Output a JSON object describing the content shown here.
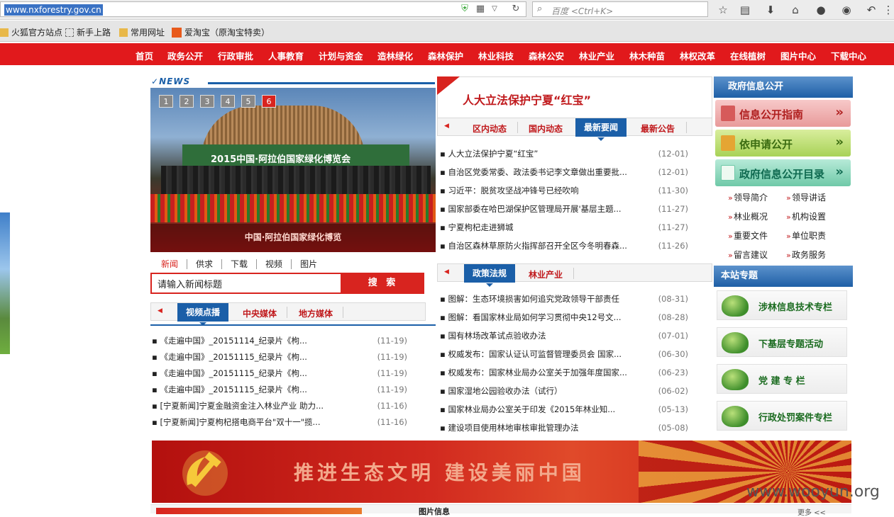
{
  "browser": {
    "url": "www.nxforestry.gov.cn",
    "search_placeholder": "百度 <Ctrl+K>",
    "bookmarks": [
      "火狐官方站点",
      "新手上路",
      "常用网址",
      "爱淘宝（原淘宝特卖）"
    ]
  },
  "nav": {
    "items": [
      "首页",
      "政务公开",
      "行政审批",
      "人事教育",
      "计划与资金",
      "造林绿化",
      "森林保护",
      "林业科技",
      "森林公安",
      "林业产业",
      "林木种苗",
      "林权改革",
      "在线植树",
      "图片中心",
      "下载中心"
    ]
  },
  "slider": {
    "numbers": [
      "1",
      "2",
      "3",
      "4",
      "5",
      "6"
    ],
    "active": "6",
    "board_text": "2015中国·阿拉伯国家绿化博览会",
    "caption": "中国·阿拉伯国家绿化博览"
  },
  "news_logo": "NEWS",
  "search": {
    "categories": [
      "新闻",
      "供求",
      "下载",
      "视频",
      "图片"
    ],
    "value": "请输入新闻标题",
    "button": "搜 索"
  },
  "video_tabs": [
    "视频点播",
    "中央媒体",
    "地方媒体"
  ],
  "video_list": [
    {
      "title": "《走遍中国》_20151114_纪录片《枸...",
      "date": "(11-19)"
    },
    {
      "title": "《走遍中国》_20151115_纪录片《枸...",
      "date": "(11-19)"
    },
    {
      "title": "《走遍中国》_20151115_纪录片《枸...",
      "date": "(11-19)"
    },
    {
      "title": "《走遍中国》_20151115_纪录片《枸...",
      "date": "(11-19)"
    },
    {
      "title": "[宁夏新闻]宁夏金融资金注入林业产业 助力...",
      "date": "(11-16)"
    },
    {
      "title": "[宁夏新闻]宁夏枸杞搭电商平台\"双十一\"揽...",
      "date": "(11-16)"
    }
  ],
  "headline": "人大立法保护宁夏“红宝”",
  "news_tabs": [
    "区内动态",
    "国内动态",
    "最新要闻",
    "最新公告"
  ],
  "news_list": [
    {
      "title": "人大立法保护宁夏“红宝”",
      "date": "(12-01)"
    },
    {
      "title": "自治区党委常委、政法委书记李文章做出重要批...",
      "date": "(12-01)"
    },
    {
      "title": "习近平：脱贫攻坚战冲锋号已经吹响",
      "date": "(11-30)"
    },
    {
      "title": "国家部委在哈巴湖保护区管理局开展'基层主题...",
      "date": "(11-27)"
    },
    {
      "title": "宁夏枸杞走进狮城",
      "date": "(11-27)"
    },
    {
      "title": "自治区森林草原防火指挥部召开全区今冬明春森...",
      "date": "(11-26)"
    }
  ],
  "policy_tabs": [
    "政策法规",
    "林业产业"
  ],
  "policy_list": [
    {
      "title": "图解：生态环境损害如何追究党政领导干部责任",
      "date": "(08-31)"
    },
    {
      "title": "图解：看国家林业局如何学习贯彻中央12号文...",
      "date": "(08-28)"
    },
    {
      "title": "国有林场改革试点验收办法",
      "date": "(07-01)"
    },
    {
      "title": "权威发布：国家认证认可监督管理委员会 国家...",
      "date": "(06-30)"
    },
    {
      "title": "权威发布：国家林业局办公室关于加强年度国家...",
      "date": "(06-23)"
    },
    {
      "title": "国家湿地公园验收办法（试行）",
      "date": "(06-02)"
    },
    {
      "title": "国家林业局办公室关于印发《2015年林业知...",
      "date": "(05-13)"
    },
    {
      "title": "建设项目使用林地审核审批管理办法",
      "date": "(05-08)"
    }
  ],
  "right": {
    "title": "政府信息公开",
    "buttons": [
      "信息公开指南",
      "依申请公开",
      "政府信息公开目录"
    ],
    "links": [
      "领导简介",
      "领导讲话",
      "林业概况",
      "机构设置",
      "重要文件",
      "单位职责",
      "留言建议",
      "政务服务"
    ],
    "special_title": "本站专题",
    "specials": [
      "涉林信息技术专栏",
      "下基层专题活动",
      "党 建 专 栏",
      "行政处罚案件专栏"
    ]
  },
  "banner": {
    "slogan": "推进生态文明 建设美丽中国"
  },
  "bottom": {
    "pic_title": "图片信息",
    "more": "更多 <<"
  },
  "watermark": "www.wooyun.org",
  "colors": {
    "nav_red": "#e1191c",
    "accent_blue": "#1b5fa8",
    "headline_red": "#c0191c"
  }
}
